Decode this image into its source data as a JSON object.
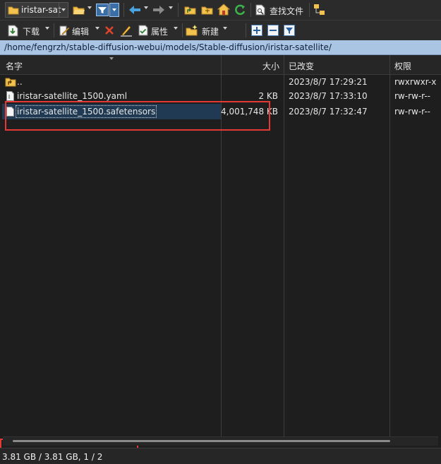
{
  "toolbar_top": {
    "location_combo_value": "iristar-sat",
    "find_files_label": "查找文件"
  },
  "toolbar_bottom": {
    "download_label": "下载",
    "edit_label": "编辑",
    "properties_label": "属性",
    "new_label": "新建"
  },
  "path": "/home/fengrzh/stable-diffusion-webui/models/Stable-diffusion/iristar-satellite/",
  "columns": {
    "name": "名字",
    "size": "大小",
    "modified": "已改变",
    "permissions": "权限"
  },
  "files": [
    {
      "name": "..",
      "size": "",
      "modified": "2023/8/7 17:29:21",
      "permissions": "rwxrwxr-x",
      "icon": "parent-folder-icon"
    },
    {
      "name": "iristar-satellite_1500.yaml",
      "size": "2 KB",
      "modified": "2023/8/7 17:33:10",
      "permissions": "rw-rw-r--",
      "icon": "text-file-icon"
    },
    {
      "name": "iristar-satellite_1500.safetensors",
      "size": "4,001,748 KB",
      "modified": "2023/8/7 17:32:47",
      "permissions": "rw-rw-r--",
      "icon": "file-icon"
    }
  ],
  "status_text": "3.81 GB / 3.81 GB,  1 / 2",
  "colors": {
    "background": "#1e1e1e",
    "path_bar": "#aac4e4",
    "selection": "#1f3a52",
    "highlight": "#e53935"
  }
}
